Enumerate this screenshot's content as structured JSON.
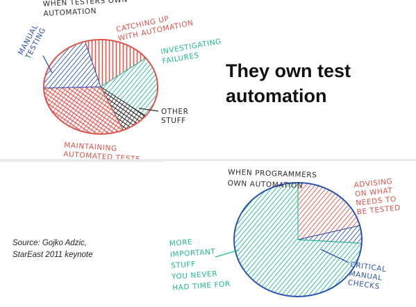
{
  "headline": "They own test automation",
  "source": [
    "Source: Gojko Adzic,",
    "StarEast 2011 keynote"
  ],
  "colors": {
    "red": "#e0524a",
    "teal": "#1fb896",
    "blue": "#2a52b8",
    "dark": "#2b2b2b"
  },
  "chart_data": [
    {
      "type": "pie",
      "title": "WHEN TESTERS OWN AUTOMATION",
      "title_lines": [
        "WHEN TESTERS OWN",
        "AUTOMATION"
      ],
      "style": "hand-drawn hatched sketch",
      "slices": [
        {
          "label": "CATCHING UP WITH AUTOMATION",
          "label_lines": [
            "CATCHING UP",
            "WITH AUTOMATION"
          ],
          "value": 19,
          "color": "#e0524a",
          "hatch": "vertical"
        },
        {
          "label": "INVESTIGATING FAILURES",
          "label_lines": [
            "INVESTIGATING",
            "FAILURES"
          ],
          "value": 21,
          "color": "#1fb896",
          "hatch": "diagonal"
        },
        {
          "label": "OTHER STUFF",
          "label_lines": [
            "OTHER",
            "STUFF"
          ],
          "value": 8,
          "color": "#2b2b2b",
          "hatch": "cross"
        },
        {
          "label": "MAINTAINING AUTOMATED TESTS",
          "label_lines": [
            "MAINTAINING",
            "AUTOMATED TESTS"
          ],
          "value": 31,
          "color": "#e0524a",
          "hatch": "cross"
        },
        {
          "label": "MANUAL TESTING",
          "label_lines": [
            "MANUAL",
            "TESTING"
          ],
          "value": 21,
          "color": "#2a52b8",
          "hatch": "diagonal"
        }
      ]
    },
    {
      "type": "pie",
      "title": "WHEN PROGRAMMERS OWN AUTOMATION",
      "title_lines": [
        "WHEN PROGRAMMERS",
        "OWN AUTOMATION"
      ],
      "style": "hand-drawn hatched sketch",
      "slices": [
        {
          "label": "ADVISING ON WHAT NEEDS TO BE TESTED",
          "label_lines": [
            "ADVISING",
            "ON WHAT",
            "NEEDS TO",
            "BE TESTED"
          ],
          "value": 21,
          "color": "#e0524a",
          "hatch": "diagonal"
        },
        {
          "label": "CRITICAL MANUAL CHECKS",
          "label_lines": [
            "CRITICAL",
            "MANUAL",
            "CHECKS"
          ],
          "value": 5,
          "color": "#2a52b8",
          "hatch": "diagonal"
        },
        {
          "label": "MORE IMPORTANT STUFF YOU NEVER HAD TIME FOR",
          "label_lines": [
            "MORE",
            "IMPORTANT",
            "STUFF",
            "YOU NEVER",
            "HAD TIME FOR"
          ],
          "value": 74,
          "color": "#1fb896",
          "hatch": "diagonal"
        }
      ]
    }
  ]
}
